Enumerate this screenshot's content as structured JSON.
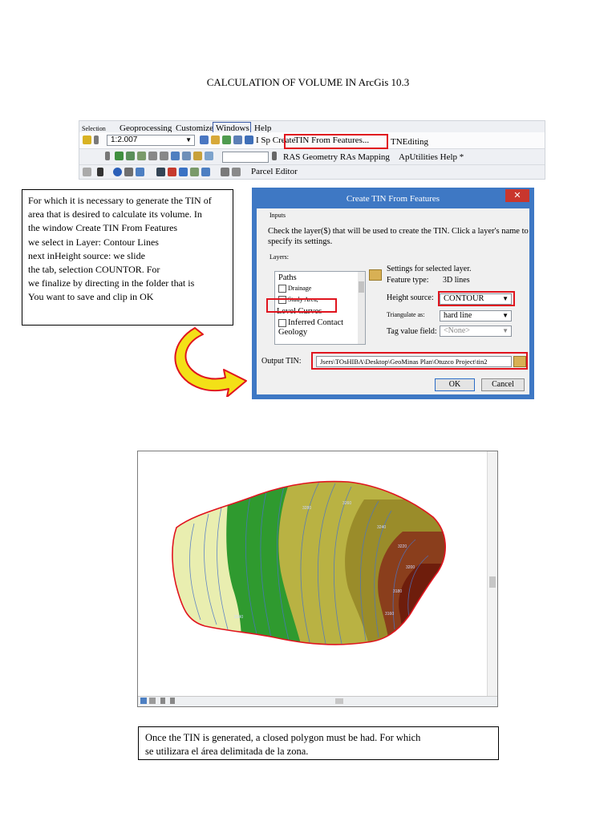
{
  "document": {
    "title": "CALCULATION OF VOLUME IN ArcGis 10.3",
    "explanation_lines": [
      "For which it is necessary to generate the TIN of",
      "area that is desired to calculate its volume. In",
      "the window Create TIN From Features",
      "we select in Layer: Contour Lines",
      "next inHeight source: we slide",
      "the tab, selection COUNTOR. For",
      "we finalize by directing in the folder that is",
      "You want to save and clip in OK"
    ],
    "bottom_note_lines": [
      "Once the TIN is generated, a closed polygon must be had. For which",
      "se utilizara el área delimitada de la zona."
    ]
  },
  "toolbar": {
    "menu": {
      "selection": "Selection",
      "geoprocessing": "Geoprocessing",
      "customize": "Customize",
      "windows": "Windows",
      "help": "Help",
      "create_tin_prefix": "I Sp Create",
      "create_tin_item": "TIN From Features...",
      "tn_editing": "TNEditing"
    },
    "scale_value": "1:2.007",
    "row2": {
      "ras_geometry": "RAS Geometry RAs Mapping",
      "ap_utilities": "ApUtilities Help *"
    },
    "row3": {
      "parcel_editor": "Parcel Editor"
    }
  },
  "dialog": {
    "title": "Create TIN From Features",
    "close_glyph": "✕",
    "inputs_label": "Inputs",
    "instruction": "Check the layer($) that will be used to create the TIN. Click a layer's name to specify its settings.",
    "layers_label": "Layers:",
    "layers": [
      {
        "name": "Paths",
        "checked": false,
        "has_box": false
      },
      {
        "name": "Drainage",
        "checked": false,
        "has_box": true
      },
      {
        "name": "Study Area,",
        "checked": false,
        "has_box": true
      },
      {
        "name": "Level Curves",
        "checked": true,
        "has_box": true
      },
      {
        "name": "Inferred Contact",
        "checked": false,
        "has_box": true
      },
      {
        "name": "Geology",
        "checked": false,
        "has_box": false
      }
    ],
    "settings_label": "Settings for selected layer.",
    "feature_type_label": "Feature type:",
    "feature_type_value": "3D lines",
    "height_source_label": "Height source:",
    "height_source_value": "CONTOUR",
    "triangulate_label": "Triangulate as:",
    "triangulate_value": "hard line",
    "tag_value_label": "Tag value field:",
    "tag_value_value": "<None>",
    "output_tin_label": "Output TIN:",
    "output_tin_value": "Jsers\\TOsHIBA\\Desktop\\GeoMinas Plan\\Otuzco Project\\tin2",
    "ok_label": "OK",
    "cancel_label": "Cancel"
  },
  "map": {
    "contour_labels": [
      "3280",
      "3260",
      "3240",
      "3220",
      "3200",
      "3180",
      "3160",
      "3140"
    ],
    "colors": {
      "light": "#e9eeb0",
      "green": "#2f9a2f",
      "olive_light": "#b9b243",
      "olive": "#9a8c2a",
      "brown": "#8a3e1c",
      "dark_brown": "#6e1d0c",
      "boundary": "#e0141e"
    }
  },
  "colors": {
    "highlight_red": "#e0141e",
    "dialog_frame": "#3e78c4",
    "arrow_fill": "#f3e017",
    "arrow_stroke": "#e0141e"
  }
}
